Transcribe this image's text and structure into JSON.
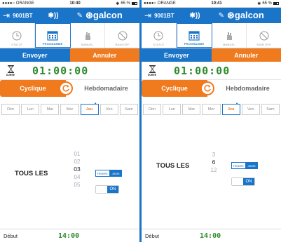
{
  "left": {
    "status": {
      "carrier": "●●●●○ ORANGE",
      "time": "10:40",
      "battery": "65 %"
    },
    "device": "9001BT",
    "logo": "galcon",
    "tabs": [
      "STATUT",
      "PROGRAMME",
      "MANUEL",
      "RAIN OFF"
    ],
    "send": "Envoyer",
    "cancel": "Annuler",
    "duration_label": "DUREE",
    "duration": "01:00:00",
    "mode_left": "Cyclique",
    "mode_right": "Hebdomadaire",
    "days": [
      "Dim",
      "Lun",
      "Mar",
      "Mer",
      "Jeu",
      "Ven",
      "Sam"
    ],
    "selected_day": "Jeu",
    "tous_les": "TOUS LES",
    "wheel": [
      "01",
      "02",
      "03",
      "04",
      "05"
    ],
    "wheel_selected": "03",
    "unit_hours": "Heures",
    "unit_days": "Jours",
    "on_label": "ON",
    "debut_label": "Début",
    "debut_value": "14:00"
  },
  "right": {
    "status": {
      "carrier": "●●●●○ ORANGE",
      "time": "10:41",
      "battery": "65 %"
    },
    "device": "9001BT",
    "logo": "galcon",
    "tabs": [
      "STATUT",
      "PROGRAMME",
      "MANUEL",
      "RAIN OFF"
    ],
    "send": "Envoyer",
    "cancel": "Annuler",
    "duration_label": "DUREE",
    "duration": "01:00:00",
    "mode_left": "Cyclique",
    "mode_right": "Hebdomadaire",
    "days": [
      "Dim",
      "Lun",
      "Mar",
      "Mer",
      "Jeu",
      "Ven",
      "Sam"
    ],
    "selected_day": "Jeu",
    "tous_les": "TOUS LES",
    "wheel": [
      "3",
      "6",
      "12"
    ],
    "wheel_selected": "6",
    "unit_hours": "Heures",
    "unit_days": "Jours",
    "on_label": "ON",
    "debut_label": "Début",
    "debut_value": "14:00"
  },
  "colors": {
    "blue": "#1a75c9",
    "orange": "#f07a1e",
    "green": "#2e8b2e"
  }
}
